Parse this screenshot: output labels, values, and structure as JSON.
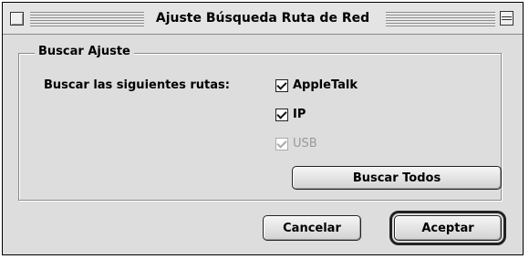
{
  "window": {
    "title": "Ajuste Búsqueda Ruta de Red"
  },
  "group": {
    "legend": "Buscar Ajuste",
    "label": "Buscar las siguientes rutas:",
    "options": [
      {
        "label": "AppleTalk",
        "checked": true,
        "enabled": true
      },
      {
        "label": "IP",
        "checked": true,
        "enabled": true
      },
      {
        "label": "USB",
        "checked": true,
        "enabled": false
      }
    ],
    "search_all_label": "Buscar Todos"
  },
  "buttons": {
    "cancel_label": "Cancelar",
    "accept_label": "Aceptar"
  },
  "icons": {
    "close": "close-box-icon",
    "collapse": "collapse-box-icon",
    "checkbox": "checkmark-icon"
  }
}
